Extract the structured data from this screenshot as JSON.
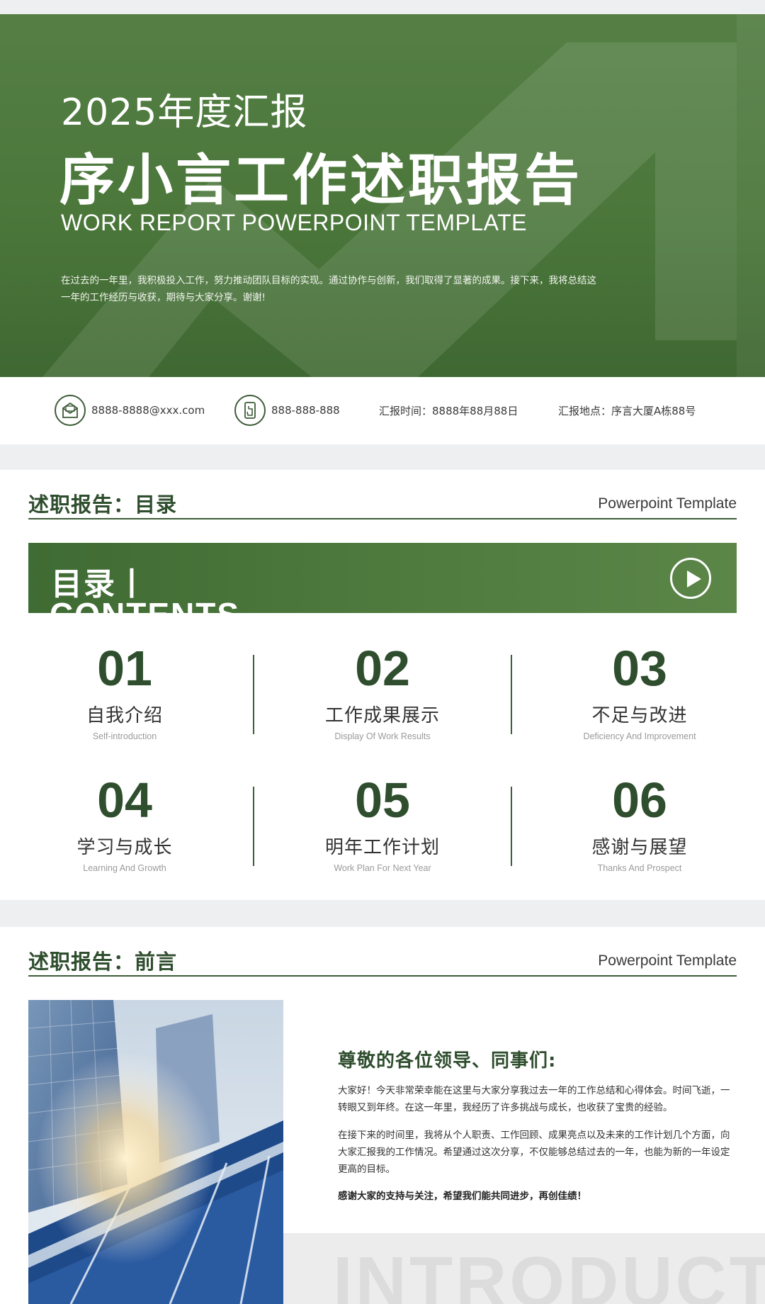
{
  "cover": {
    "subtitle": "2025年度汇报",
    "title": "序小言工作述职报告",
    "english_title": "WORK REPORT POWERPOINT TEMPLATE",
    "description": "在过去的一年里，我积极投入工作，努力推动团队目标的实现。通过协作与创新，我们取得了显著的成果。接下来，我将总结这一年的工作经历与收获，期待与大家分享。谢谢!"
  },
  "contact": {
    "email": "8888-8888@xxx.com",
    "phone": "888-888-888",
    "time": "汇报时间：8888年88月88日",
    "location": "汇报地点：序言大厦A栋88号",
    "email_icon": "mail-icon",
    "phone_icon": "phone-icon"
  },
  "contents_slide": {
    "header": "述职报告：目录",
    "tag": "Powerpoint Template",
    "banner_cn": "目录丨",
    "banner_en": "CONTENTS",
    "items": [
      {
        "num": "01",
        "cn": "自我介绍",
        "en": "Self-introduction"
      },
      {
        "num": "02",
        "cn": "工作成果展示",
        "en": "Display Of Work Results"
      },
      {
        "num": "03",
        "cn": "不足与改进",
        "en": "Deficiency And Improvement"
      },
      {
        "num": "04",
        "cn": "学习与成长",
        "en": "Learning And Growth"
      },
      {
        "num": "05",
        "cn": "明年工作计划",
        "en": "Work Plan For Next Year"
      },
      {
        "num": "06",
        "cn": "感谢与展望",
        "en": "Thanks And Prospect"
      }
    ]
  },
  "preface_slide": {
    "header": "述职报告：前言",
    "tag": "Powerpoint Template",
    "greeting": "尊敬的各位领导、同事们:",
    "p1": "大家好！今天非常荣幸能在这里与大家分享我过去一年的工作总结和心得体会。时间飞逝，一转眼又到年终。在这一年里，我经历了许多挑战与成长，也收获了宝贵的经验。",
    "p2": "在接下来的时间里，我将从个人职责、工作回顾、成果亮点以及未来的工作计划几个方面，向大家汇报我的工作情况。希望通过这次分享，不仅能够总结过去的一年，也能为新的一年设定更高的目标。",
    "p3": "感谢大家的支持与关注，希望我们能共同进步，再创佳绩！",
    "watermark": "INTRODUCTIO"
  },
  "colors": {
    "brand_green": "#4b773b",
    "dark_green": "#2f4e2e"
  }
}
